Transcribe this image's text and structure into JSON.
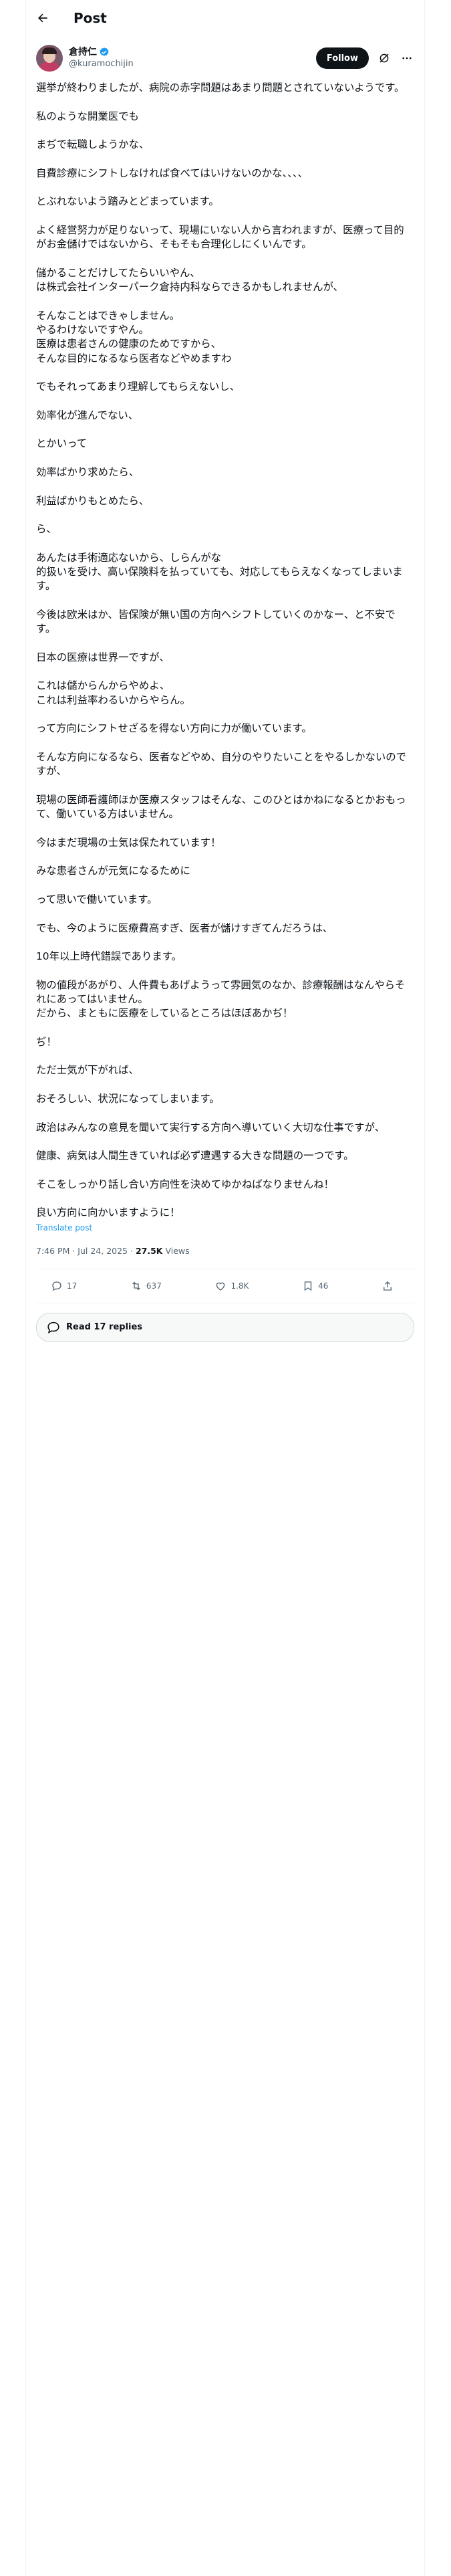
{
  "header": {
    "title": "Post"
  },
  "author": {
    "display_name": "倉持仁",
    "handle": "@kuramochijin",
    "follow_label": "Follow"
  },
  "tweet": {
    "text": "選挙が終わりましたが、病院の赤字問題はあまり問題とされていないようです。\n\n私のような開業医でも\n\nまぢで転職しようかな、\n\n自費診療にシフトしなければ食べてはいけないのかな、、、、\n\nとぶれないよう踏みとどまっています。\n\nよく経営努力が足りないって、現場にいない人から言われますが、医療って目的がお金儲けではないから、そもそも合理化しにくいんです。\n\n儲かることだけしてたらいいやん、\nは株式会社インターパーク倉持内科ならできるかもしれませんが、\n\nそんなことはできゃしません。\nやるわけないですやん。\n医療は患者さんの健康のためですから、\nそんな目的になるなら医者などやめますわ\n\nでもそれってあまり理解してもらえないし、\n\n効率化が進んでない、\n\nとかいって\n\n効率ばかり求めたら、\n\n利益ばかりもとめたら、\n\nら、\n\nあんたは手術適応ないから、しらんがな\n的扱いを受け、高い保険料を払っていても、対応してもらえなくなってしまいます。\n\n今後は欧米はか、皆保険が無い国の方向へシフトしていくのかなー、と不安です。\n\n日本の医療は世界一ですが、\n\nこれは儲からんからやめよ、\nこれは利益率わるいからやらん。\n\nって方向にシフトせざるを得ない方向に力が働いています。\n\nそんな方向になるなら、医者などやめ、自分のやりたいことをやるしかないのですが、\n\n現場の医師看護師ほか医療スタッフはそんな、このひとはかねになるとかおもって、働いている方はいません。\n\n今はまだ現場の士気は保たれています！\n\nみな患者さんが元気になるために\n\nって思いで働いています。\n\nでも、今のように医療費高すぎ、医者が儲けすぎてんだろうは、\n\n10年以上時代錯誤であります。\n\n物の値段があがり、人件費もあげようって雰囲気のなか、診療報酬はなんやらそれにあってはいません。\nだから、まともに医療をしているところはほぼあかぢ！\n\nぢ！\n\nただ士気が下がれば、\n\nおそろしい、状況になってしまいます。\n\n政治はみんなの意見を聞いて実行する方向へ導いていく大切な仕事ですが、\n\n健康、病気は人間生きていれば必ず遭遇する大きな問題の一つです。\n\nそこをしっかり話し合い方向性を決めてゆかねばなりませんね！\n\n良い方向に向かいますように！",
    "translate_label": "Translate post",
    "timestamp": "7:46 PM · Jul 24, 2025",
    "separator": " · ",
    "views_count": "27.5K",
    "views_label": " Views"
  },
  "stats": {
    "replies": "17",
    "reposts": "637",
    "likes": "1.8K",
    "bookmarks": "46"
  },
  "read_replies_label": "Read 17 replies",
  "icons": [
    "back-arrow-icon",
    "verified-badge-icon",
    "grok-icon",
    "more-icon",
    "reply-icon",
    "repost-icon",
    "like-icon",
    "bookmark-icon",
    "share-icon",
    "speech-bubble-icon"
  ],
  "colors": {
    "accent": "#1d9bf0",
    "text": "#0f1419",
    "secondary": "#536471"
  }
}
